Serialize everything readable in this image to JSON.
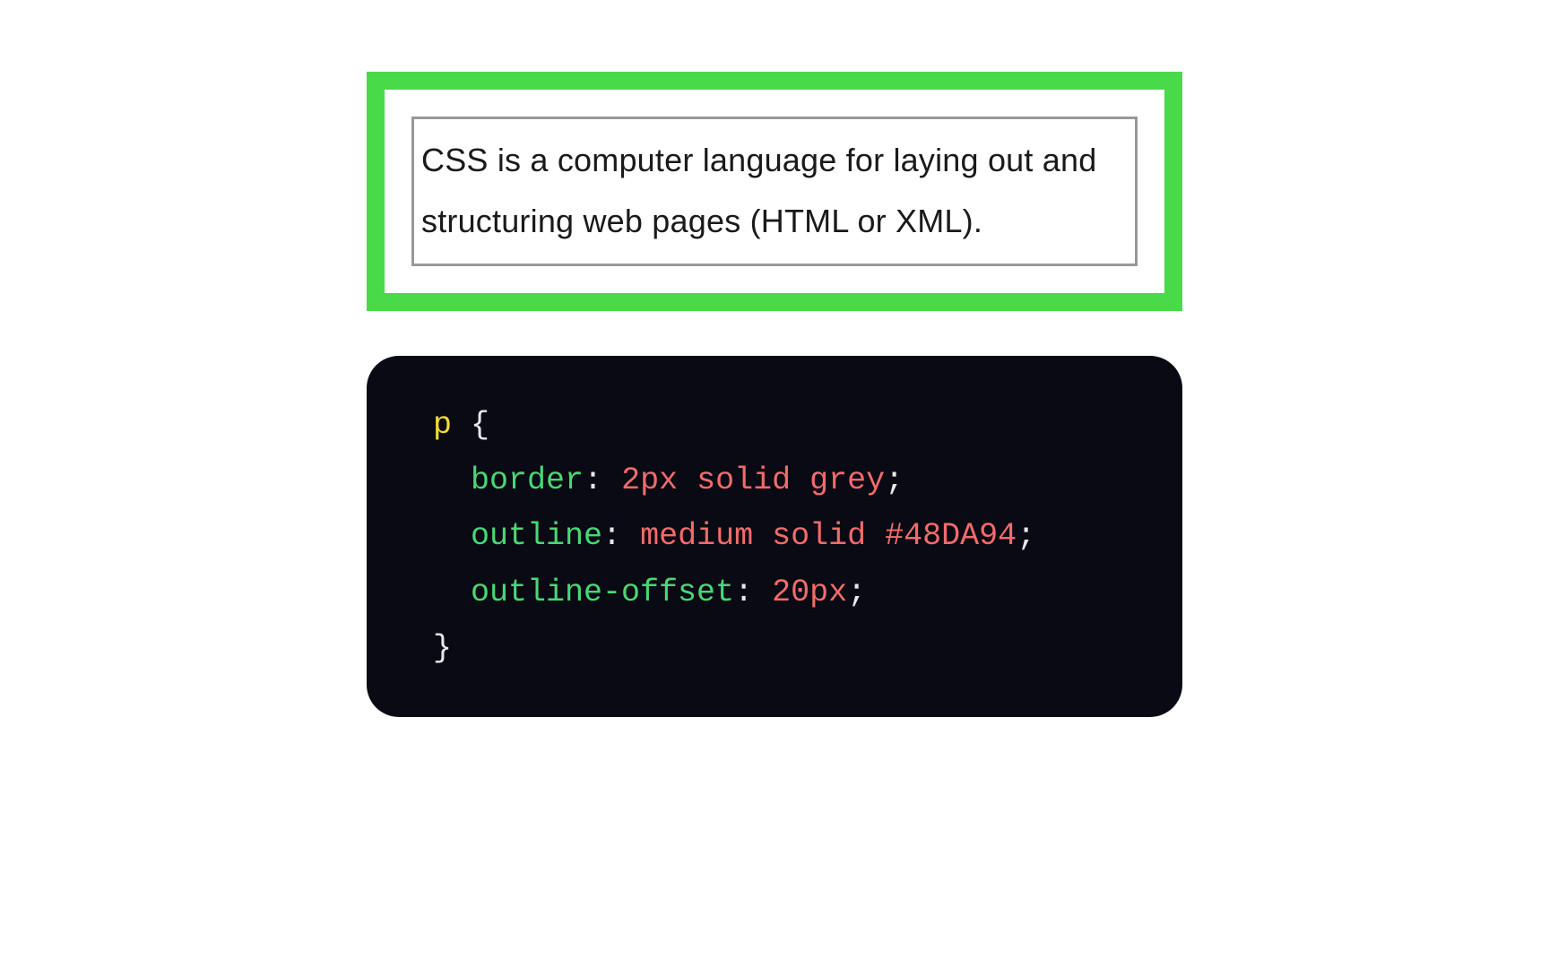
{
  "example": {
    "paragraph_text": "CSS is a computer language for laying out and structuring web pages (HTML or XML)."
  },
  "code": {
    "line1_selector": "p",
    "line1_brace_open": " {",
    "line2_indent": "  ",
    "line2_property": "border",
    "line2_colon": ": ",
    "line2_value": "2px solid grey",
    "line2_semi": ";",
    "line3_indent": "  ",
    "line3_property": "outline",
    "line3_colon": ": ",
    "line3_value": "medium solid #48DA94",
    "line3_semi": ";",
    "line4_indent": "  ",
    "line4_property": "outline-offset",
    "line4_colon": ": ",
    "line4_value": "20px",
    "line4_semi": ";",
    "line5_brace_close": "}"
  }
}
